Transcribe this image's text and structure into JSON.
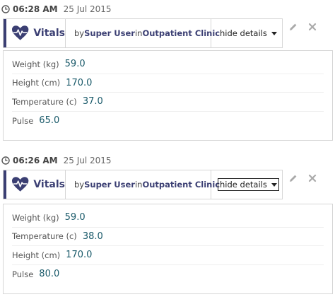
{
  "encounters": [
    {
      "time": "06:28 AM",
      "date": "25 Jul 2015",
      "title": "Vitals",
      "by_prefix": "by",
      "user": "Super User",
      "in_word": "in",
      "location": "Outpatient Clinic",
      "toggle_label": "hide details",
      "toggle_focused": false,
      "observations": [
        {
          "label": "Weight (kg)",
          "value": "59.0"
        },
        {
          "label": "Height (cm)",
          "value": "170.0"
        },
        {
          "label": "Temperature (c)",
          "value": "37.0"
        },
        {
          "label": "Pulse",
          "value": "65.0"
        }
      ]
    },
    {
      "time": "06:26 AM",
      "date": "25 Jul 2015",
      "title": "Vitals",
      "by_prefix": "by",
      "user": "Super User",
      "in_word": "in",
      "location": "Outpatient Clinic",
      "toggle_label": "hide details",
      "toggle_focused": true,
      "observations": [
        {
          "label": "Weight (kg)",
          "value": "59.0"
        },
        {
          "label": "Temperature (c)",
          "value": "38.0"
        },
        {
          "label": "Height (cm)",
          "value": "170.0"
        },
        {
          "label": "Pulse",
          "value": "80.0"
        }
      ]
    }
  ],
  "icons": {
    "clock": "clock-icon",
    "heart": "heartbeat-icon",
    "edit": "pencil-icon",
    "delete": "close-icon",
    "toggle": "caret-down-icon"
  },
  "colors": {
    "brand": "#3b3f73",
    "value": "#1a5a6a",
    "border": "#d6d6d6"
  }
}
